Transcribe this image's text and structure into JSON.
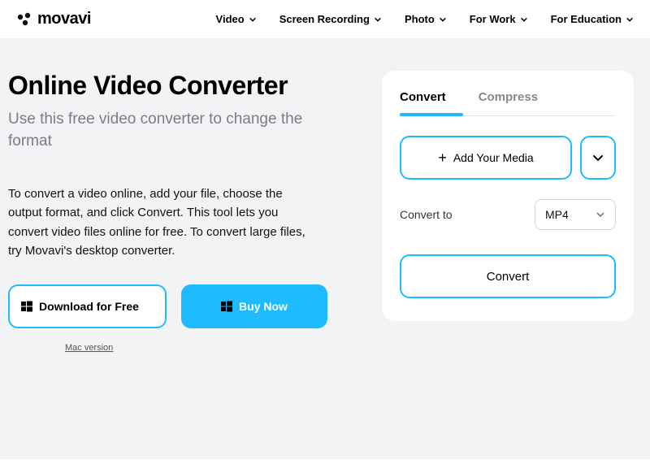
{
  "header": {
    "brand": "movavi",
    "nav": [
      {
        "label": "Video"
      },
      {
        "label": "Screen Recording"
      },
      {
        "label": "Photo"
      },
      {
        "label": "For Work"
      },
      {
        "label": "For Education"
      }
    ]
  },
  "hero": {
    "title": "Online Video Converter",
    "subtitle": "Use this free video converter to change the format",
    "description": "To convert a video online, add your file, choose the output format, and click Convert. This tool lets you convert video files online for free. To convert large files, try Movavi's desktop converter.",
    "download_label": "Download for Free",
    "buy_label": "Buy Now",
    "mac_link": "Mac version"
  },
  "card": {
    "tabs": [
      {
        "label": "Convert"
      },
      {
        "label": "Compress"
      }
    ],
    "add_media_label": "Add Your Media",
    "convert_to_label": "Convert to",
    "format_selected": "MP4",
    "convert_button": "Convert"
  }
}
